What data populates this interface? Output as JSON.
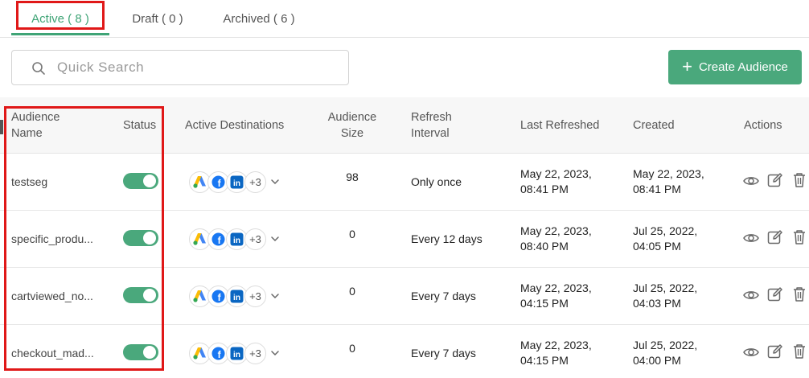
{
  "tabs": [
    {
      "label": "Active ( 8 )"
    },
    {
      "label": "Draft ( 0 )"
    },
    {
      "label": "Archived ( 6 )"
    }
  ],
  "search": {
    "placeholder": "Quick Search"
  },
  "create_button": {
    "label": "Create Audience"
  },
  "table": {
    "headers": {
      "name_line1": "Audience",
      "name_line2": "Name",
      "status": "Status",
      "destinations": "Active Destinations",
      "size_line1": "Audience",
      "size_line2": "Size",
      "refresh_line1": "Refresh",
      "refresh_line2": "Interval",
      "last_refreshed": "Last Refreshed",
      "created": "Created",
      "actions": "Actions"
    },
    "rows": [
      {
        "name": "testseg",
        "status": "on",
        "more": "+3",
        "size": "98",
        "refresh": "Only once",
        "last_1": "May 22, 2023,",
        "last_2": "08:41 PM",
        "created_1": "May 22, 2023,",
        "created_2": "08:41 PM"
      },
      {
        "name": "specific_produ...",
        "status": "on",
        "more": "+3",
        "size": "0",
        "refresh": "Every 12 days",
        "last_1": "May 22, 2023,",
        "last_2": "08:40 PM",
        "created_1": "Jul 25, 2022,",
        "created_2": "04:05 PM"
      },
      {
        "name": "cartviewed_no...",
        "status": "on",
        "more": "+3",
        "size": "0",
        "refresh": "Every 7 days",
        "last_1": "May 22, 2023,",
        "last_2": "04:15 PM",
        "created_1": "Jul 25, 2022,",
        "created_2": "04:03 PM"
      },
      {
        "name": "checkout_mad...",
        "status": "on",
        "more": "+3",
        "size": "0",
        "refresh": "Every 7 days",
        "last_1": "May 22, 2023,",
        "last_2": "04:15 PM",
        "created_1": "Jul 25, 2022,",
        "created_2": "04:00 PM"
      }
    ]
  },
  "colors": {
    "accent": "#4aa87c",
    "highlight": "#e01818"
  }
}
